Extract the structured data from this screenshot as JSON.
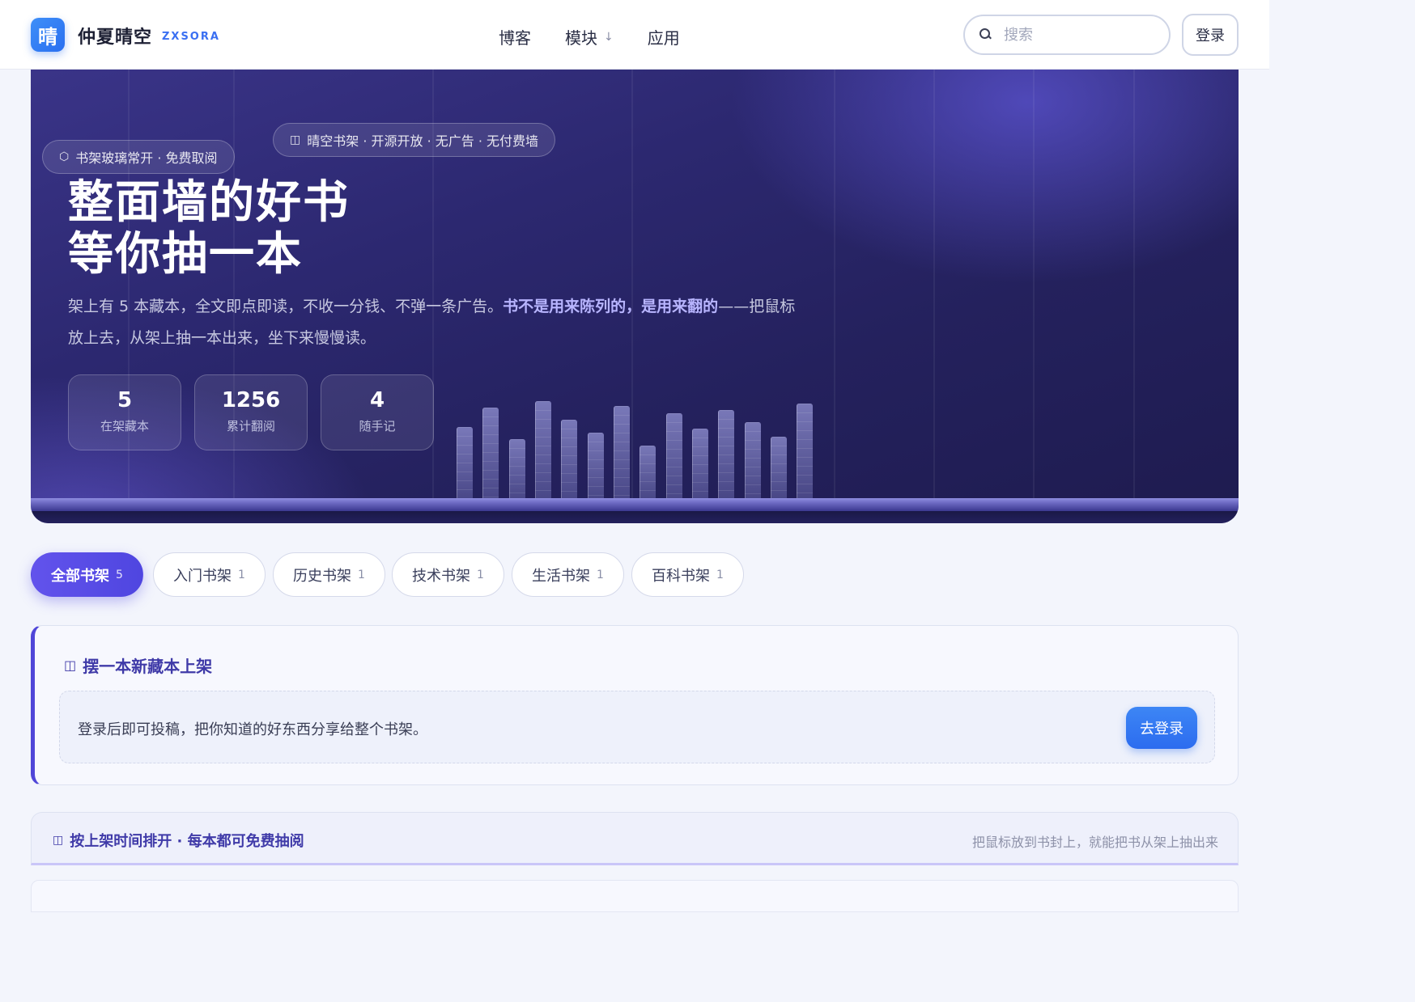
{
  "nav": {
    "logo_char": "晴",
    "brand": "仲夏晴空",
    "brand_sub": "ZXSORA",
    "links": [
      {
        "label": "博客"
      },
      {
        "label": "模块",
        "arrow": "↓"
      },
      {
        "label": "应用"
      }
    ],
    "search_placeholder": "搜索",
    "login_label": "登录"
  },
  "hero": {
    "chip_left": "书架玻璃常开 · 免费取阅",
    "chip_right": "晴空书架 · 开源开放 · 无广告 · 无付费墙",
    "chip_left_icon": "cube-icon",
    "chip_right_icon": "open-book-icon",
    "title_line1": "整面墙的好书",
    "title_line2": "等你抽一本",
    "desc_part1": "架上有 5 本藏本，全文即点即读，不收一分钱、不弹一条广告。",
    "desc_highlight": "书不是用来陈列的，是用来翻的",
    "desc_part2": "——把鼠标放上去，从架上抽一本出来，坐下来慢慢读。",
    "stats": [
      {
        "value": "5",
        "label": "在架藏本"
      },
      {
        "value": "1256",
        "label": "累计翻阅"
      },
      {
        "value": "4",
        "label": "随手记"
      }
    ]
  },
  "categories": [
    {
      "label": "全部书架",
      "count": "5",
      "active": true
    },
    {
      "label": "入门书架",
      "count": "1",
      "active": false
    },
    {
      "label": "历史书架",
      "count": "1",
      "active": false
    },
    {
      "label": "技术书架",
      "count": "1",
      "active": false
    },
    {
      "label": "生活书架",
      "count": "1",
      "active": false
    },
    {
      "label": "百科书架",
      "count": "1",
      "active": false
    }
  ],
  "submit": {
    "title": "摆一本新藏本上架",
    "text": "登录后即可投稿，把你知道的好东西分享给整个书架。",
    "button": "去登录"
  },
  "list": {
    "title": "按上架时间排开 · 每本都可免费抽阅",
    "hint": "把鼠标放到书封上，就能把书从架上抽出来"
  },
  "colors": {
    "accent": "#5046d8",
    "primary_blue": "#2c6cef",
    "hero_bg": "#24215d"
  }
}
